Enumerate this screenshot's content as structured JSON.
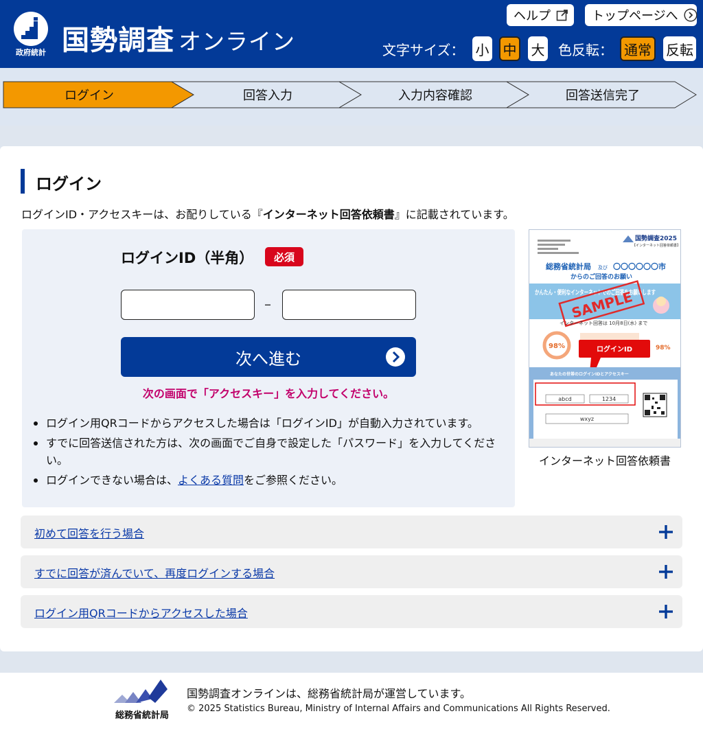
{
  "header": {
    "logo_small_text": "政府統計",
    "title": "国勢調査",
    "title_sub": "オンライン",
    "help_label": "ヘルプ",
    "top_label": "トップページへ",
    "font_size_label": "文字サイズ：",
    "font_sizes": [
      "小",
      "中",
      "大"
    ],
    "font_size_selected": "中",
    "color_invert_label": "色反転：",
    "color_modes": [
      "通常",
      "反転"
    ],
    "color_mode_selected": "通常"
  },
  "steps": [
    {
      "label": "ログイン",
      "active": true
    },
    {
      "label": "回答入力",
      "active": false
    },
    {
      "label": "入力内容確認",
      "active": false
    },
    {
      "label": "回答送信完了",
      "active": false
    }
  ],
  "main": {
    "heading": "ログイン",
    "intro_before": "ログインID・アクセスキーは、お配りしている『",
    "intro_bold": "インターネット回答依頼書",
    "intro_after": "』に記載されています。",
    "login_id_label": "ログインID（半角）",
    "required_badge": "必須",
    "id_separator": "–",
    "login_id_part1": "",
    "login_id_part2": "",
    "next_button": "次へ進む",
    "next_note": "次の画面で「アクセスキー」を入力してください。",
    "bullets": [
      "ログイン用QRコードからアクセスした場合は「ログインID」が自動入力されています。",
      "すでに回答送信された方は、次の画面でご自身で設定した「パスワード」を入力してください。"
    ],
    "bullet3_before": "ログインできない場合は、",
    "bullet3_link": "よくある質問",
    "bullet3_after": "をご参照ください。",
    "sample_caption": "インターネット回答依頼書",
    "sample_doc": {
      "brand": "国勢調査2025",
      "subtitle": "【インターネット回答依頼書】",
      "from_line1": "総務省統計局",
      "from_and": "及び",
      "from_city": "〇〇〇〇〇〇市",
      "from_line2": "からのご回答のお願い",
      "banner": "かんたん・便利なインターネットでのご回答をお願いします",
      "stamp": "SAMPLE",
      "deadline": "インターネット回答は 10月8日(水) まで",
      "pct": "98%",
      "callout": "ログインID",
      "id_box_title": "あなたの世帯のログインIDとアクセスキー",
      "login_id_example": "abcd",
      "login_id_example2": "1234",
      "access_key_example": "wxyz"
    }
  },
  "accordion": [
    "初めて回答を行う場合",
    "すでに回答が済んでいて、再度ログインする場合",
    "ログイン用QRコードからアクセスした場合"
  ],
  "footer": {
    "logo_text": "総務省統計局",
    "operated_by": "国勢調査オンラインは、総務省統計局が運営しています。",
    "copyright": "© 2025 Statistics Bureau, Ministry of Internal Affairs and Communications All Rights Reserved."
  },
  "colors": {
    "brand_blue": "#033a98",
    "accent_orange": "#f39800",
    "required_red": "#d8061c",
    "note_magenta": "#c2006b",
    "link_blue": "#0b3aa8"
  }
}
